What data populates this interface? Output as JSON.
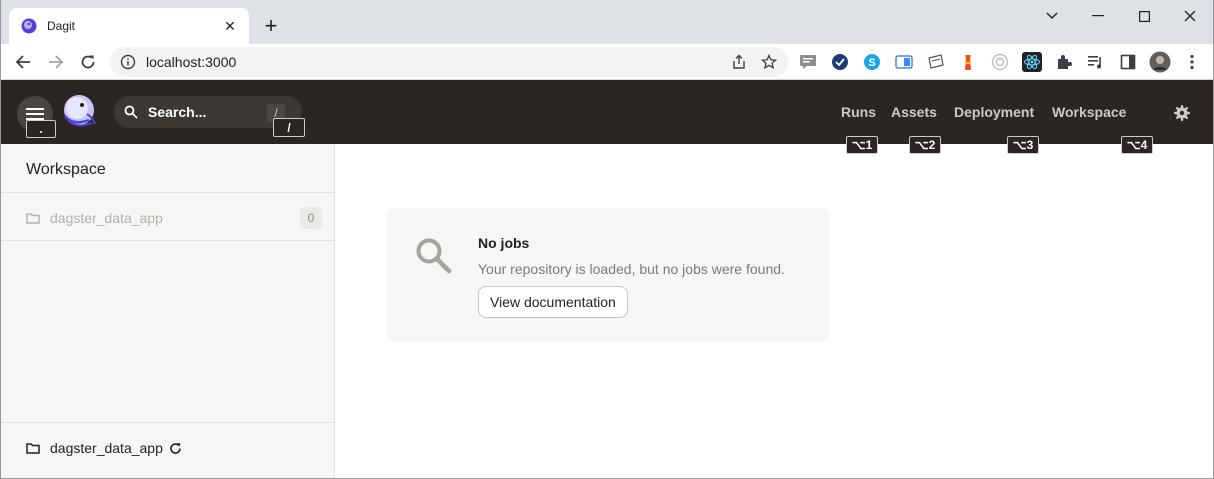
{
  "browser": {
    "tab_title": "Dagit",
    "url": "localhost:3000"
  },
  "header": {
    "menu_shortcut": ".",
    "search_placeholder": "Search...",
    "search_shortcut": "/",
    "search_shortcut_badge": "/",
    "nav": [
      {
        "label": "Runs",
        "shortcut": "⌥1"
      },
      {
        "label": "Assets",
        "shortcut": "⌥2"
      },
      {
        "label": "Deployment",
        "shortcut": "⌥3"
      },
      {
        "label": "Workspace",
        "shortcut": "⌥4"
      }
    ]
  },
  "sidebar": {
    "title": "Workspace",
    "repo_name": "dagster_data_app",
    "repo_count": "0",
    "footer_repo": "dagster_data_app"
  },
  "main": {
    "empty_title": "No jobs",
    "empty_description": "Your repository is loaded, but no jobs were found.",
    "doc_button": "View documentation"
  },
  "colors": {
    "header_bg": "#2b2621",
    "sidebar_bg": "#f7f6f4",
    "accent_logo": "#4f43dd"
  }
}
